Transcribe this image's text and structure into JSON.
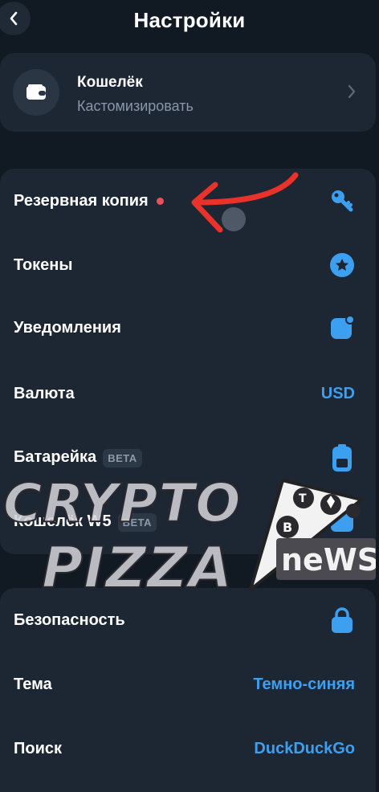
{
  "header": {
    "title": "Настройки"
  },
  "wallet": {
    "title": "Кошелёк",
    "subtitle": "Кастомизировать"
  },
  "group1": [
    {
      "label": "Резервная копия",
      "icon": "key-icon",
      "has_dot": true
    },
    {
      "label": "Токены",
      "icon": "star-circle-icon"
    },
    {
      "label": "Уведомления",
      "icon": "notification-square-icon"
    },
    {
      "label": "Валюта",
      "value": "USD"
    },
    {
      "label": "Батарейка",
      "badge": "BETA",
      "icon": "battery-icon"
    },
    {
      "label": "Кошелёк W5",
      "badge": "BETA",
      "icon": "wallet-w5-icon"
    }
  ],
  "group2": [
    {
      "label": "Безопасность",
      "icon": "lock-icon"
    },
    {
      "label": "Тема",
      "value": "Темно-синяя"
    },
    {
      "label": "Поиск",
      "value": "DuckDuckGo"
    }
  ],
  "watermark": {
    "line1": "CRYPTO",
    "line2": "PIZZA",
    "badge": "neWS"
  },
  "colors": {
    "background": "#111923",
    "card": "#1d2633",
    "accent": "#3d9ff0",
    "dot": "#e8505b",
    "arrow": "#e8322a"
  }
}
